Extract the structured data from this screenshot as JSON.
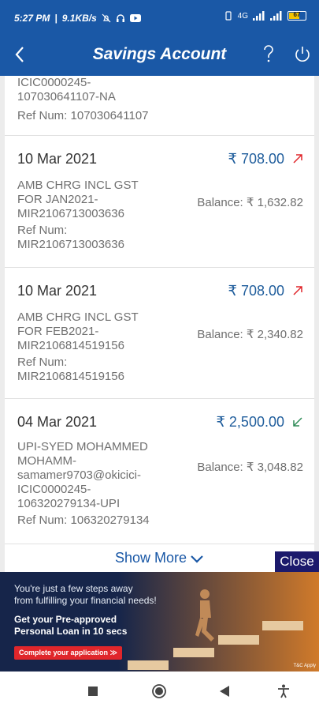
{
  "status_bar": {
    "time": "5:27 PM",
    "speed": "9.1KB/s",
    "battery_level": "67",
    "network": "4G"
  },
  "app_bar": {
    "title": "Savings Account",
    "back_icon": "chevron-left-icon",
    "help_icon": "question-icon",
    "logout_icon": "power-icon"
  },
  "partial_top": {
    "desc_lines": [
      "ICIC0000245-",
      "107030641107-NA"
    ],
    "ref": "Ref Num: 107030641107"
  },
  "transactions": [
    {
      "date": "10 Mar 2021",
      "amount": "₹ 708.00",
      "direction": "debit",
      "desc_lines": [
        "AMB CHRG INCL GST",
        "FOR JAN2021-",
        "MIR2106713003636"
      ],
      "balance": "Balance: ₹ 1,632.82",
      "ref_lines": [
        "Ref Num:",
        "MIR2106713003636"
      ]
    },
    {
      "date": "10 Mar 2021",
      "amount": "₹ 708.00",
      "direction": "debit",
      "desc_lines": [
        "AMB CHRG INCL GST",
        "FOR FEB2021-",
        "MIR2106814519156"
      ],
      "balance": "Balance: ₹ 2,340.82",
      "ref_lines": [
        "Ref Num:",
        "MIR2106814519156"
      ]
    },
    {
      "date": "04 Mar 2021",
      "amount": "₹ 2,500.00",
      "direction": "credit",
      "desc_lines": [
        "UPI-SYED MOHAMMED",
        "MOHAMM-",
        "samamer9703@okicici-",
        "ICIC0000245-",
        "106320279134-UPI"
      ],
      "balance": "Balance: ₹ 3,048.82",
      "ref_lines": [
        "Ref Num: 106320279134"
      ]
    }
  ],
  "show_more_label": "Show More",
  "close_label": "Close",
  "ad": {
    "line1": "You're just a few steps away",
    "line2": "from fulfilling your financial needs!",
    "line3": "Get your Pre-approved",
    "line4": "Personal Loan in 10 secs",
    "cta": "Complete your application ≫",
    "tnc": "T&C Apply"
  },
  "colors": {
    "brand_blue": "#1a58a6",
    "amount_blue": "#1f5d9c",
    "debit_red": "#e0262b",
    "credit_green": "#2e8b57"
  }
}
